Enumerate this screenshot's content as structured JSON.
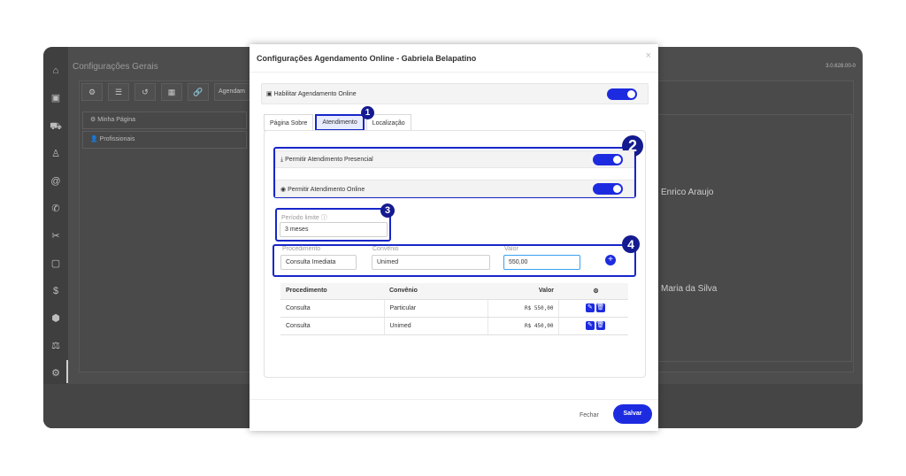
{
  "background": {
    "title": "Configurações Gerais",
    "version": "3.0.628.00-0",
    "toolbar_tools": [
      "⚙",
      "☰",
      "↺",
      "▦",
      "🔗"
    ],
    "toolbar_wide_label": "Agendam",
    "list_items": [
      {
        "icon": "⚙",
        "label": "Minha Página"
      },
      {
        "icon": "👤",
        "label": "Profissionais"
      }
    ],
    "names": [
      "Enrico Araujo",
      "Maria da Silva"
    ],
    "sidebar_icons": [
      "⌂",
      "▣",
      "⛟",
      "♙",
      "@",
      "✆",
      "✂",
      "▢",
      "$",
      "⬢",
      "⚖",
      "⚙"
    ]
  },
  "modal": {
    "title": "Configurações Agendamento Online - Gabriela Belapatino",
    "close_symbol": "×",
    "enable_label": "Habilitar Agendamento Online",
    "tabs": [
      {
        "label": "Página Sobre",
        "active": false
      },
      {
        "label": "Atendimento",
        "active": true
      },
      {
        "label": "Localização",
        "active": false
      }
    ],
    "options": [
      {
        "label": "Permitir Atendimento Presencial",
        "enabled": true
      },
      {
        "label": "Permitir Atendimento Online",
        "enabled": true
      }
    ],
    "period": {
      "label": "Período limite",
      "value": "3 meses"
    },
    "procedure_form": {
      "procedure_label": "Procedimento",
      "procedure_value": "Consulta Imediata",
      "agreement_label": "Convênio",
      "agreement_value": "Unimed",
      "value_label": "Valor",
      "value_value": "550,00"
    },
    "table": {
      "headers": [
        "Procedimento",
        "Convênio",
        "Valor",
        "⚙"
      ],
      "rows": [
        {
          "procedure": "Consulta",
          "agreement": "Particular",
          "value": "R$ 550,00"
        },
        {
          "procedure": "Consulta",
          "agreement": "Unimed",
          "value": "R$ 450,00"
        }
      ]
    },
    "footer": {
      "close_label": "Fechar",
      "save_label": "Salvar"
    }
  },
  "badges": [
    "1",
    "2",
    "3",
    "4"
  ],
  "colors": {
    "accent": "#1d2be0",
    "highlight_border": "#1726c8",
    "badge": "#141a8f"
  }
}
